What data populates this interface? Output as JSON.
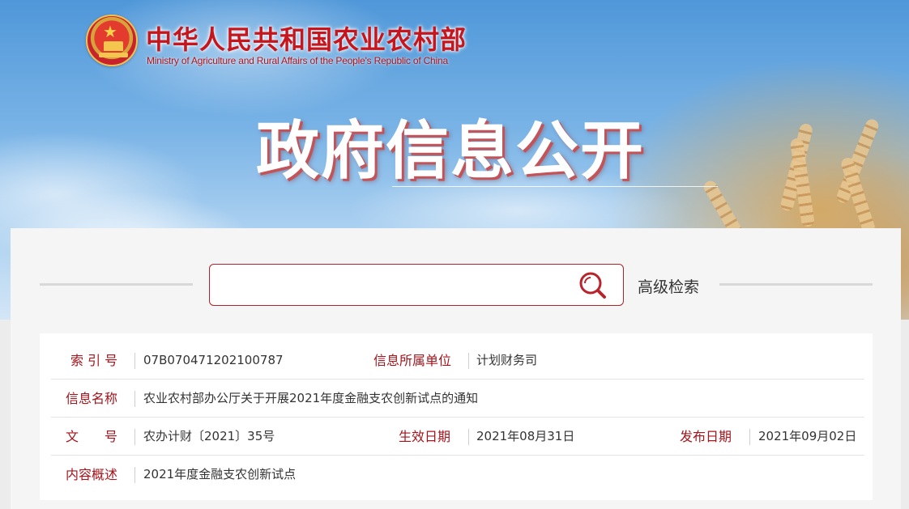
{
  "header": {
    "ministry_name_cn": "中华人民共和国农业农村部",
    "ministry_name_en": "Ministry of Agriculture and Rural Affairs of the People's Republic of China",
    "banner_title": "政府信息公开"
  },
  "search": {
    "placeholder": "",
    "value": "",
    "icon": "search-icon",
    "advanced_label": "高级检索"
  },
  "info": {
    "index_label": "索 引 号",
    "index_value": "07B070471202100787",
    "org_label": "信息所属单位",
    "org_value": "计划财务司",
    "name_label": "信息名称",
    "name_value": "农业农村部办公厅关于开展2021年度金融支农创新试点的通知",
    "doc_no_label": "文　　号",
    "doc_no_value": "农办计财〔2021〕35号",
    "effective_label": "生效日期",
    "effective_value": "2021年08月31日",
    "publish_label": "发布日期",
    "publish_value": "2021年09月02日",
    "summary_label": "内容概述",
    "summary_value": "2021年度金融支农创新试点"
  },
  "colors": {
    "brand_red": "#a3151c",
    "ministry_red": "#c5161d",
    "search_border": "#b0212a"
  }
}
